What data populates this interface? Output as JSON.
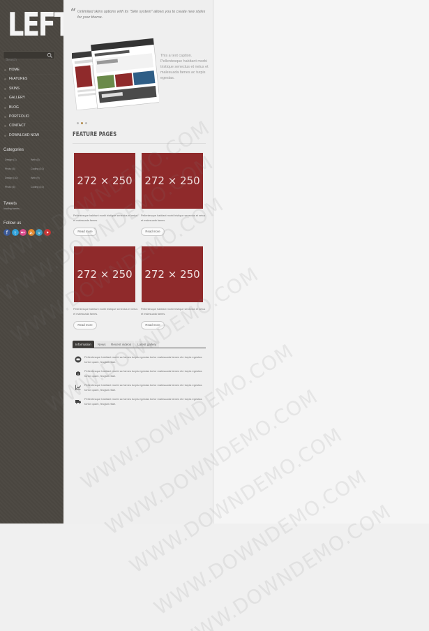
{
  "sidebar": {
    "logo": "LEFT",
    "search_placeholder": "Search",
    "nav": [
      "Home",
      "Features",
      "Skins",
      "Gallery",
      "Blog",
      "Portfolio",
      "Contact",
      "Download now"
    ],
    "categories_title": "Categories",
    "categories": [
      "Design (1)",
      "Web (8)",
      "Photo (5)",
      "Coding (10)",
      "Design (10)",
      "Web (9)",
      "Photo (6)",
      "Coding (10)"
    ],
    "tweets_title": "Tweets",
    "tweets_text": "loading tweets...",
    "follow_title": "Follow us",
    "social_icons": [
      {
        "name": "facebook-icon",
        "color": "#3b5998"
      },
      {
        "name": "twitter-icon",
        "color": "#2fa0d8"
      },
      {
        "name": "flickr-icon",
        "color": "#d84a8a"
      },
      {
        "name": "rss-icon",
        "color": "#e58a2f"
      },
      {
        "name": "vimeo-icon",
        "color": "#3aa0c8"
      },
      {
        "name": "youtube-icon",
        "color": "#c33"
      }
    ]
  },
  "quote": "Unlimited skins options with its \"Skin system\" allows you to create new styles for your theme.",
  "slider": {
    "caption": "This a text caption. Pellentesque habitant morbi tristique senectus et netus et malesuada fames ac turpis egestas."
  },
  "features": {
    "title": "FEATURE PAGES",
    "items": [
      {
        "thumb": "272 × 250",
        "text": "Pellentesque habitant morbi tristique senectus et netus et malesuada fames.",
        "button": "Read more"
      },
      {
        "thumb": "272 × 250",
        "text": "Pellentesque habitant morbi tristique senectus et netus et malesuada fames.",
        "button": "Read more"
      },
      {
        "thumb": "272 × 250",
        "text": "Pellentesque habitant morbi tristique senectus et netus et malesuada fames.",
        "button": "Read more"
      },
      {
        "thumb": "272 × 250",
        "text": "Pellentesque habitant morbi tristique senectus et netus et malesuada fames.",
        "button": "Read more"
      }
    ]
  },
  "tabs": [
    "Information",
    "News",
    "Recent videos",
    "Latest gallery"
  ],
  "info_items": [
    {
      "icon": "chat-icon",
      "text": "Pellentesque habitant morbi ac fames turpis egestas tortor malesuada fames ele turpis egestas tortor quam, feugiat vitae."
    },
    {
      "icon": "box-icon",
      "text": "Pellentesque habitant morbi ac fames turpis egestas tortor malesuada fames ele turpis egestas tortor quam, feugiat vitae."
    },
    {
      "icon": "chart-icon",
      "text": "Pellentesque habitant morbi ac fames turpis egestas tortor malesuada fames ele turpis egestas tortor quam, feugiat vitae."
    },
    {
      "icon": "truck-icon",
      "text": "Pellentesque habitant morbi ac fames turpis egestas tortor malesuada fames ele turpis egestas tortor quam, feugiat vitae."
    }
  ],
  "watermark": "WWW.DOWNDEMO.COM"
}
